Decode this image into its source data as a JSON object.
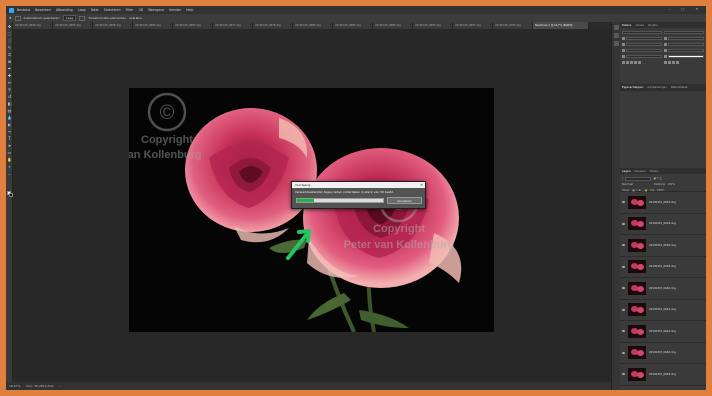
{
  "menubar": {
    "items": [
      "Bestand",
      "Bewerken",
      "Afbeelding",
      "Laag",
      "Tekst",
      "Selecteren",
      "Filter",
      "3D",
      "Weergave",
      "Venster",
      "Help"
    ]
  },
  "optionsbar": {
    "auto_select_label": "Automatisch selecteren:",
    "auto_select_value": "Laag",
    "transform_label": "Transformatie-elementen"
  },
  "tabs": [
    {
      "label": "20190315_0649.dng"
    },
    {
      "label": "20190315_0653.dng"
    },
    {
      "label": "20190315_0658.dng"
    },
    {
      "label": "20190315_0662.dng"
    },
    {
      "label": "20190315_0667.dng"
    },
    {
      "label": "20190315_0671.dng"
    },
    {
      "label": "20190315_0676.dng"
    },
    {
      "label": "20190315_0680.dng"
    },
    {
      "label": "20190315_0684.dng"
    },
    {
      "label": "20190315_0689.dng"
    },
    {
      "label": "20190315_0693.dng"
    },
    {
      "label": "20190315_0697.dng"
    },
    {
      "label": "20190315_0702.dng"
    },
    {
      "label": "Naamloos-1 @ 16,7% (RGB/8)"
    }
  ],
  "watermark": {
    "line1": "Copyright",
    "line2": "Peter van Kollenburg",
    "symbol": "©"
  },
  "dialog": {
    "title": "Voortgang",
    "message": "Verwerkbestanden tegen laden onderdelen in stack van 30 bestd.",
    "cancel_label": "Annuleren",
    "progress": 0.2
  },
  "status": {
    "zoom": "16,67%",
    "doc": "Doc: 36,2M/1,81G"
  },
  "panels": {
    "top_tabs": [
      "Tekens",
      "Alinea",
      "Glyphs"
    ],
    "mid_tabs": [
      "Eigenschappen",
      "Aanpassingen",
      "Bibliotheken"
    ],
    "layers_tabs": [
      "Lagen",
      "Kanalen",
      "Paden"
    ],
    "blend_mode": "Normaal",
    "opacity_label": "Dekking:",
    "opacity_value": "100%",
    "lock_label": "Vergr.:",
    "fill_label": "Vul:",
    "fill_value": "100%"
  },
  "layers": [
    {
      "name": "20190315_0632.dng"
    },
    {
      "name": "20190315_0634.dng"
    },
    {
      "name": "20190315_0636.dng"
    },
    {
      "name": "20190315_0638.dng"
    },
    {
      "name": "20190315_0640.dng"
    },
    {
      "name": "20190315_0642.dng"
    },
    {
      "name": "20190315_0644.dng"
    },
    {
      "name": "20190315_0646.dng"
    },
    {
      "name": "20190315_0648.dng"
    }
  ],
  "colors": {
    "accent_border": "#e0803f",
    "progress_green": "#20b34a",
    "arrow_green": "#22c55e"
  }
}
